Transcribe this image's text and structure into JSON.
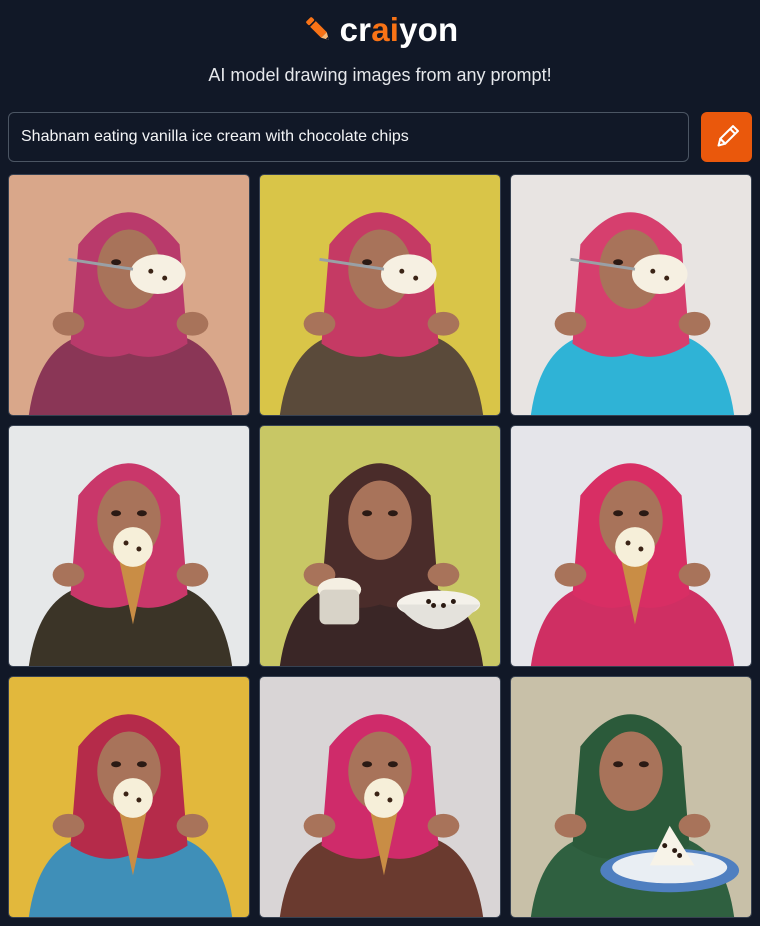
{
  "brand": {
    "prefix": "cr",
    "accent": "ai",
    "suffix": "yon",
    "accent_color": "#f97316"
  },
  "tagline": "AI model drawing images from any prompt!",
  "prompt": {
    "value": "Shabnam eating vanilla ice cream with chocolate chips"
  },
  "draw_button": {
    "icon": "pencil-icon",
    "color": "#ea580c"
  },
  "images": [
    {
      "bg": "#d9a78a",
      "scarf": "#b93a6b",
      "dress": "#8a3656",
      "treat": "cup"
    },
    {
      "bg": "#d9c548",
      "scarf": "#c53a64",
      "dress": "#5a4a3a",
      "treat": "cup"
    },
    {
      "bg": "#e8e4e2",
      "scarf": "#d63f6e",
      "dress": "#2fb3d6",
      "treat": "cup"
    },
    {
      "bg": "#e6e8e9",
      "scarf": "#c9376a",
      "dress": "#3b3427",
      "treat": "cone"
    },
    {
      "bg": "#c8c765",
      "scarf": "#4a2c2a",
      "dress": "#3a2626",
      "treat": "bowl"
    },
    {
      "bg": "#e5e5ea",
      "scarf": "#d82e64",
      "dress": "#cf2f63",
      "treat": "cone"
    },
    {
      "bg": "#e2b83c",
      "scarf": "#b52b4a",
      "dress": "#3f8fb8",
      "treat": "cone"
    },
    {
      "bg": "#d9d5d6",
      "scarf": "#cf2b6a",
      "dress": "#6a3a2f",
      "treat": "cone"
    },
    {
      "bg": "#c8c0a8",
      "scarf": "#2b5a3a",
      "dress": "#2f6040",
      "treat": "plate"
    }
  ]
}
